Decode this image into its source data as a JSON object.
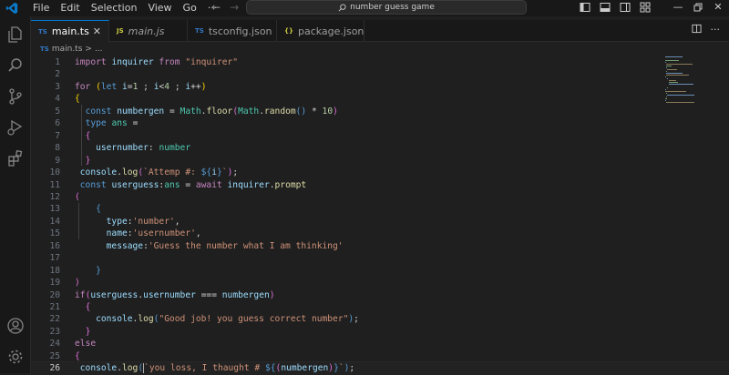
{
  "menu": [
    "File",
    "Edit",
    "Selection",
    "View",
    "Go",
    "···"
  ],
  "command_center": {
    "text": "number guess game"
  },
  "tabs": [
    {
      "badge": "TS",
      "label": "main.ts",
      "active": true
    },
    {
      "badge": "JS",
      "label": "main.js",
      "active": false
    },
    {
      "badge": "TS",
      "label": "tsconfig.json",
      "active": false
    },
    {
      "badge": "{}",
      "label": "package.json",
      "active": false
    }
  ],
  "breadcrumb": {
    "badge": "TS",
    "file": "main.ts",
    "sep": ">",
    "more": "..."
  },
  "icons": {
    "explorer": "files-icon",
    "search": "search-icon",
    "scm": "source-control-icon",
    "run": "run-debug-icon",
    "extensions": "extensions-icon",
    "account": "account-icon",
    "settings": "gear-icon"
  },
  "colors": {
    "accent": "#0078d4",
    "editor_bg": "#1f1f1f",
    "sidebar_bg": "#181818"
  },
  "code": {
    "current_line": 26,
    "lines": [
      {
        "n": "1",
        "tokens": [
          [
            "k",
            "import "
          ],
          [
            "v",
            "inquirer "
          ],
          [
            "k",
            "from "
          ],
          [
            "s",
            "\"inquirer\""
          ]
        ]
      },
      {
        "n": "2",
        "tokens": []
      },
      {
        "n": "3",
        "tokens": [
          [
            "k",
            "for "
          ],
          [
            "y",
            "("
          ],
          [
            "b",
            "let "
          ],
          [
            "v",
            "i"
          ],
          [
            "c",
            "="
          ],
          [
            "n",
            "1 "
          ],
          [
            "c",
            "; "
          ],
          [
            "v",
            "i"
          ],
          [
            "c",
            "<"
          ],
          [
            "n",
            "4 "
          ],
          [
            "c",
            "; "
          ],
          [
            "v",
            "i"
          ],
          [
            "c",
            "++"
          ],
          [
            "y",
            ")"
          ]
        ]
      },
      {
        "n": "4",
        "tokens": [
          [
            "y",
            "{"
          ]
        ]
      },
      {
        "n": "5",
        "tokens": [
          [
            "c",
            "  "
          ],
          [
            "b",
            "const "
          ],
          [
            "v",
            "numbergen "
          ],
          [
            "c",
            "= "
          ],
          [
            "t",
            "Math"
          ],
          [
            "c",
            "."
          ],
          [
            "f",
            "floor"
          ],
          [
            "p",
            "("
          ],
          [
            "t",
            "Math"
          ],
          [
            "c",
            "."
          ],
          [
            "f",
            "random"
          ],
          [
            "b",
            "() "
          ],
          [
            "c",
            "* "
          ],
          [
            "n",
            "10"
          ],
          [
            "p",
            ")"
          ]
        ]
      },
      {
        "n": "6",
        "tokens": [
          [
            "c",
            "  "
          ],
          [
            "b",
            "type "
          ],
          [
            "t",
            "ans "
          ],
          [
            "c",
            "="
          ]
        ]
      },
      {
        "n": "7",
        "tokens": [
          [
            "c",
            "  "
          ],
          [
            "p",
            "{"
          ]
        ]
      },
      {
        "n": "8",
        "tokens": [
          [
            "c",
            "    "
          ],
          [
            "v",
            "usernumber"
          ],
          [
            "c",
            ": "
          ],
          [
            "t",
            "number"
          ]
        ]
      },
      {
        "n": "9",
        "tokens": [
          [
            "c",
            "  "
          ],
          [
            "p",
            "}"
          ]
        ]
      },
      {
        "n": "10",
        "tokens": [
          [
            "c",
            " "
          ],
          [
            "v",
            "console"
          ],
          [
            "c",
            "."
          ],
          [
            "f",
            "log"
          ],
          [
            "p",
            "("
          ],
          [
            "s",
            "`Attemp #: "
          ],
          [
            "b",
            "${"
          ],
          [
            "v",
            "i"
          ],
          [
            "b",
            "}"
          ],
          [
            "s",
            "`"
          ],
          [
            "p",
            ")"
          ],
          [
            "c",
            ";"
          ]
        ]
      },
      {
        "n": "11",
        "tokens": [
          [
            "c",
            " "
          ],
          [
            "b",
            "const "
          ],
          [
            "v",
            "userguess"
          ],
          [
            "c",
            ":"
          ],
          [
            "t",
            "ans "
          ],
          [
            "c",
            "= "
          ],
          [
            "k",
            "await "
          ],
          [
            "v",
            "inquirer"
          ],
          [
            "c",
            "."
          ],
          [
            "f",
            "prompt"
          ]
        ]
      },
      {
        "n": "12",
        "tokens": [
          [
            "p",
            "("
          ]
        ]
      },
      {
        "n": "13",
        "tokens": [
          [
            "c",
            "    "
          ],
          [
            "b",
            "{"
          ]
        ]
      },
      {
        "n": "14",
        "tokens": [
          [
            "c",
            "      "
          ],
          [
            "v",
            "type"
          ],
          [
            "c",
            ":"
          ],
          [
            "s",
            "'number'"
          ],
          [
            "c",
            ","
          ]
        ]
      },
      {
        "n": "15",
        "tokens": [
          [
            "c",
            "      "
          ],
          [
            "v",
            "name"
          ],
          [
            "c",
            ":"
          ],
          [
            "s",
            "'usernumber'"
          ],
          [
            "c",
            ","
          ]
        ]
      },
      {
        "n": "16",
        "tokens": [
          [
            "c",
            "      "
          ],
          [
            "v",
            "message"
          ],
          [
            "c",
            ":"
          ],
          [
            "s",
            "'Guess the number what I am thinking'"
          ]
        ]
      },
      {
        "n": "17",
        "tokens": []
      },
      {
        "n": "18",
        "tokens": [
          [
            "c",
            "    "
          ],
          [
            "b",
            "}"
          ]
        ]
      },
      {
        "n": "19",
        "tokens": [
          [
            "p",
            ")"
          ]
        ]
      },
      {
        "n": "20",
        "tokens": [
          [
            "k",
            "if"
          ],
          [
            "p",
            "("
          ],
          [
            "v",
            "userguess"
          ],
          [
            "c",
            "."
          ],
          [
            "v",
            "usernumber "
          ],
          [
            "c",
            "=== "
          ],
          [
            "v",
            "numbergen"
          ],
          [
            "p",
            ")"
          ]
        ]
      },
      {
        "n": "21",
        "tokens": [
          [
            "c",
            "  "
          ],
          [
            "p",
            "{"
          ]
        ]
      },
      {
        "n": "22",
        "tokens": [
          [
            "c",
            "    "
          ],
          [
            "v",
            "console"
          ],
          [
            "c",
            "."
          ],
          [
            "f",
            "log"
          ],
          [
            "b",
            "("
          ],
          [
            "s",
            "\"Good job! you guess correct number\""
          ],
          [
            "b",
            ")"
          ],
          [
            "c",
            ";"
          ]
        ]
      },
      {
        "n": "23",
        "tokens": [
          [
            "c",
            "  "
          ],
          [
            "p",
            "}"
          ]
        ]
      },
      {
        "n": "24",
        "tokens": [
          [
            "k",
            "else"
          ]
        ]
      },
      {
        "n": "25",
        "tokens": [
          [
            "p",
            "{"
          ]
        ]
      },
      {
        "n": "26",
        "tokens": [
          [
            "c",
            " "
          ],
          [
            "v",
            "console"
          ],
          [
            "c",
            "."
          ],
          [
            "f",
            "log"
          ],
          [
            "b",
            "("
          ],
          [
            "cursor",
            ""
          ],
          [
            "s",
            "`you loss, I thaught # "
          ],
          [
            "b",
            "${"
          ],
          [
            "p",
            "("
          ],
          [
            "v",
            "numbergen"
          ],
          [
            "p",
            ")"
          ],
          [
            "b",
            "}"
          ],
          [
            "s",
            "`"
          ],
          [
            "b",
            ")"
          ],
          [
            "c",
            ";"
          ]
        ]
      }
    ]
  }
}
